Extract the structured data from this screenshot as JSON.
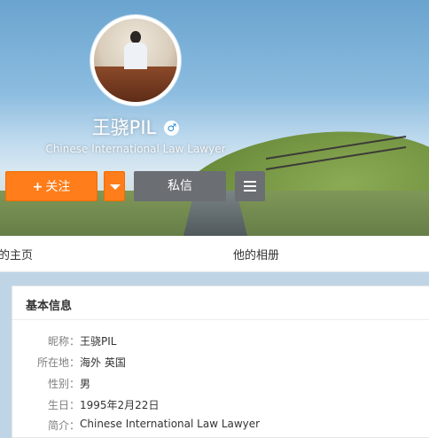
{
  "profile": {
    "name": "王骁PIL",
    "gender_icon": "male-icon",
    "gender_symbol": "♂",
    "intro": "Chinese International Law Lawyer"
  },
  "actions": {
    "follow_label": "关注",
    "follow_plus": "+",
    "message_label": "私信"
  },
  "tabs": [
    {
      "label": "的主页"
    },
    {
      "label": "他的相册"
    }
  ],
  "info_card": {
    "title": "基本信息",
    "rows": [
      {
        "label": "昵称：",
        "value": "王骁PIL"
      },
      {
        "label": "所在地：",
        "value": "海外 英国"
      },
      {
        "label": "性别：",
        "value": "男"
      },
      {
        "label": "生日：",
        "value": "1995年2月22日"
      },
      {
        "label": "简介：",
        "value": "Chinese International Law Lawyer"
      }
    ]
  },
  "colors": {
    "follow_button": "#ff7d1a",
    "message_button": "#6b6e73",
    "gender_icon": "#2a8fd6"
  }
}
